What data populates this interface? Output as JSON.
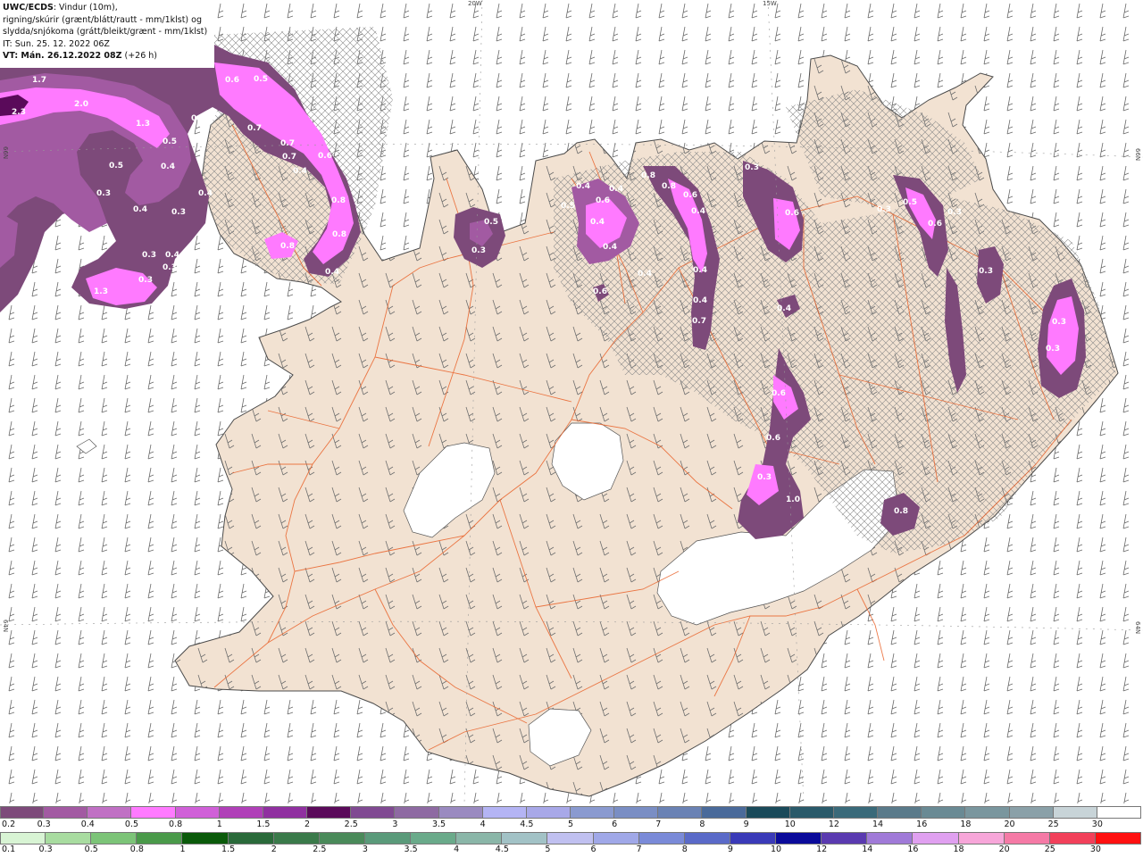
{
  "header": {
    "line1_bold": "UWC/ECDS",
    "line1_rest": ": Vindur (10m),",
    "line2": "rigning/skúrir (grænt/blátt/rautt - mm/1klst) og",
    "line3": "slydda/snjókoma (grátt/bleikt/grænt - mm/1klst)",
    "line4": "IT: Sun. 25. 12. 2022 06Z",
    "line5_bold": "VT: Mán. 26.12.2022 08Z",
    "line5_rest": " (+26 h)"
  },
  "grid_labels": {
    "top_20w": "20W",
    "top_15w": "15W",
    "left_66n": "66N",
    "right_66n": "66N",
    "left_64n": "64N",
    "right_64n": "64N"
  },
  "colors": {
    "land": "#f2e2d2",
    "sea": "#ffffff",
    "roads": "#e9622a",
    "coast": "#4a4a4a",
    "wind_barbs": "#666666"
  },
  "precip_values": {
    "snow": [
      "1.7",
      "2.3",
      "2.0",
      "1.3",
      "0.5",
      "0.5",
      "0.4",
      "0.3",
      "0.4",
      "0.3",
      "0.4",
      "0.3",
      "0.4",
      "0.3",
      "0.3",
      "1.3",
      "0.6",
      "0.5",
      "0.5",
      "0.7",
      "0.7",
      "0.7",
      "0.4",
      "0.6",
      "0.8",
      "0.8",
      "0.8",
      "0.4",
      "0.4",
      "0.4",
      "0.3",
      "0.5",
      "0.5",
      "0.4",
      "0.6",
      "0.4",
      "0.4",
      "0.4",
      "0.8",
      "0.8",
      "0.6",
      "0.4",
      "0.4",
      "0.4",
      "0.7",
      "0.4",
      "0.6",
      "0.3",
      "0.6",
      "0.4",
      "0.3",
      "0.5",
      "0.6",
      "0.3",
      "0.3",
      "0.6",
      "0.6",
      "0.3",
      "1.0",
      "0.8",
      "0.3",
      "0.3"
    ]
  },
  "legend": {
    "snow_ticks": [
      "0.2",
      "0.3",
      "0.4",
      "0.5",
      "0.8",
      "1",
      "1.5",
      "2",
      "2.5",
      "3",
      "3.5",
      "4",
      "4.5",
      "5",
      "6",
      "7",
      "8",
      "9",
      "10",
      "12",
      "14",
      "16",
      "18",
      "20",
      "25",
      "30"
    ],
    "snow_colors": [
      "#7d4a7a",
      "#a25aa2",
      "#c070c4",
      "#ff7aff",
      "#d060d8",
      "#b040b8",
      "#9030a0",
      "#5a0a5a",
      "#804a92",
      "#8e6aa2",
      "#9a8ac0",
      "#b4b4f4",
      "#a8a8e8",
      "#8a9ad0",
      "#7a8ec4",
      "#6a82b4",
      "#4a6a9a",
      "#1a4a5a",
      "#2a5a6a",
      "#3a6a7a",
      "#5a7a8a",
      "#6a8a94",
      "#7a969e",
      "#8aa0a8",
      "#c8d4d8",
      "#ffffff"
    ],
    "rain_ticks": [
      "0.1",
      "0.3",
      "0.5",
      "0.8",
      "1",
      "1.5",
      "2",
      "2.5",
      "3",
      "3.5",
      "4",
      "4.5",
      "5",
      "6",
      "7",
      "8",
      "9",
      "10",
      "12",
      "14",
      "16",
      "18",
      "20",
      "25",
      "30"
    ],
    "rain_colors": [
      "#d8f4d4",
      "#a8dca0",
      "#7cc478",
      "#4a9a4a",
      "#0a5a0a",
      "#2a6a3a",
      "#3a7a4a",
      "#4a8a5a",
      "#5a9a7a",
      "#6aaa8a",
      "#8ab6a8",
      "#a2c2c6",
      "#c0c0f0",
      "#a0a8e8",
      "#7a8ad8",
      "#5a6ac8",
      "#3a3ab8",
      "#0a0a9a",
      "#5a3ab0",
      "#a07ad8",
      "#e0a0f0",
      "#f7a6d9",
      "#f57aa6",
      "#f2405a",
      "#ff1010"
    ]
  }
}
